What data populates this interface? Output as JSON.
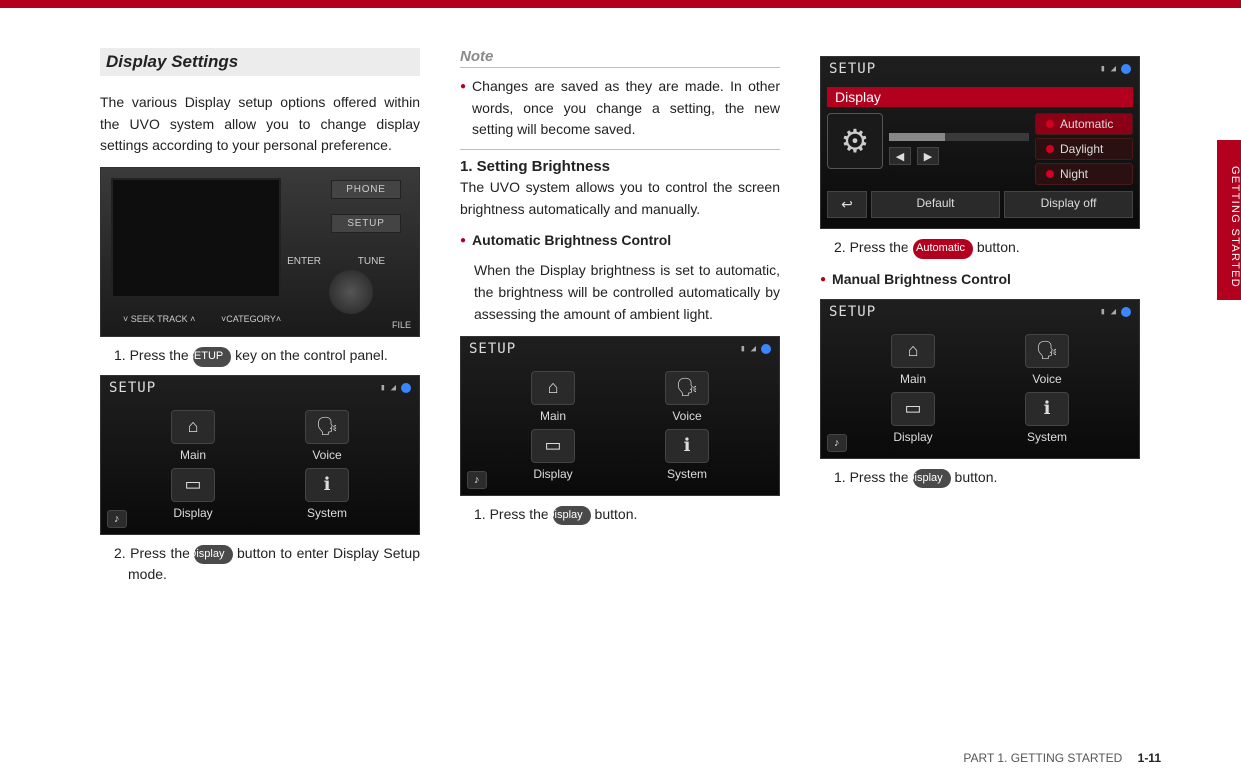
{
  "side_tab": "GETTING STARTED",
  "footer": {
    "part": "PART 1. GETTING STARTED",
    "page": "1-11"
  },
  "keys": {
    "setup": "SETUP",
    "display": "Display",
    "automatic": "Automatic"
  },
  "col1": {
    "title": "Display Settings",
    "intro": "The various Display setup options offered within the UVO system allow you to change display settings according to your personal preference.",
    "step1_a": "1. Press the ",
    "step1_b": " key on the control panel.",
    "step2_a": "2. Press the ",
    "step2_b": " button to enter Display Setup mode.",
    "hw": {
      "phone": "PHONE",
      "setup": "SETUP",
      "enter": "ENTER",
      "tune": "TUNE",
      "seek": "˅  SEEK TRACK  ˄",
      "cat": "˅CATEGORY˄",
      "file": "FILE"
    },
    "setup_fig": {
      "title": "SETUP",
      "main": "Main",
      "voice": "Voice",
      "display": "Display",
      "system": "System"
    }
  },
  "col2": {
    "note_head": "Note",
    "note_item": "Changes are saved as they are made. In other words, once you change a setting, the new setting will become saved.",
    "sub1": "1. Setting Brightness",
    "sub1_body": "The UVO system allows you to control the screen brightness automatically and manually.",
    "auto_head": "Automatic Brightness Control",
    "auto_body": "When the Display brightness is set to automatic, the brightness will be controlled automatically by assessing the amount of ambient light.",
    "step1_a": "1. Press the ",
    "step1_b": " button.",
    "setup_fig": {
      "title": "SETUP",
      "main": "Main",
      "voice": "Voice",
      "display": "Display",
      "system": "System"
    }
  },
  "col3": {
    "bright_fig": {
      "title": "SETUP",
      "header": "Display",
      "opt_auto": "Automatic",
      "opt_day": "Daylight",
      "opt_night": "Night",
      "back": "↩",
      "default": "Default",
      "off": "Display off"
    },
    "step2_a": "2. Press the ",
    "step2_b": " button.",
    "manual_head": "Manual Brightness Control",
    "setup_fig": {
      "title": "SETUP",
      "main": "Main",
      "voice": "Voice",
      "display": "Display",
      "system": "System"
    },
    "step1_a": "1. Press the ",
    "step1_b": " button."
  }
}
